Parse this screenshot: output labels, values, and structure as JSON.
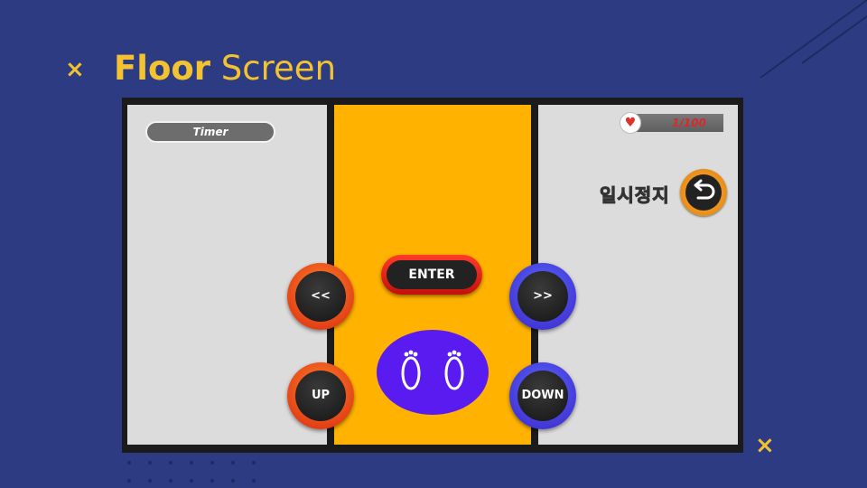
{
  "slide": {
    "title_bold": "Floor",
    "title_rest": " Screen",
    "deco_mark": "×"
  },
  "game": {
    "timer_label": "Timer",
    "hp": {
      "text": "1/100",
      "icon": "heart-icon"
    },
    "pause": {
      "label": "일시정지",
      "icon": "undo-arrow-icon"
    },
    "controls": {
      "left": "<<",
      "right": ">>",
      "up": "UP",
      "down": "DOWN",
      "enter": "ENTER"
    },
    "footpad_icon": "footprints-icon"
  },
  "colors": {
    "background": "#2d3c82",
    "accent": "#f2c230",
    "lane": "#ffb300",
    "side_panel": "#dcdcdc",
    "button_red": "#d9230f",
    "button_blue": "#3a22c8",
    "footpad": "#5a1bf0"
  }
}
